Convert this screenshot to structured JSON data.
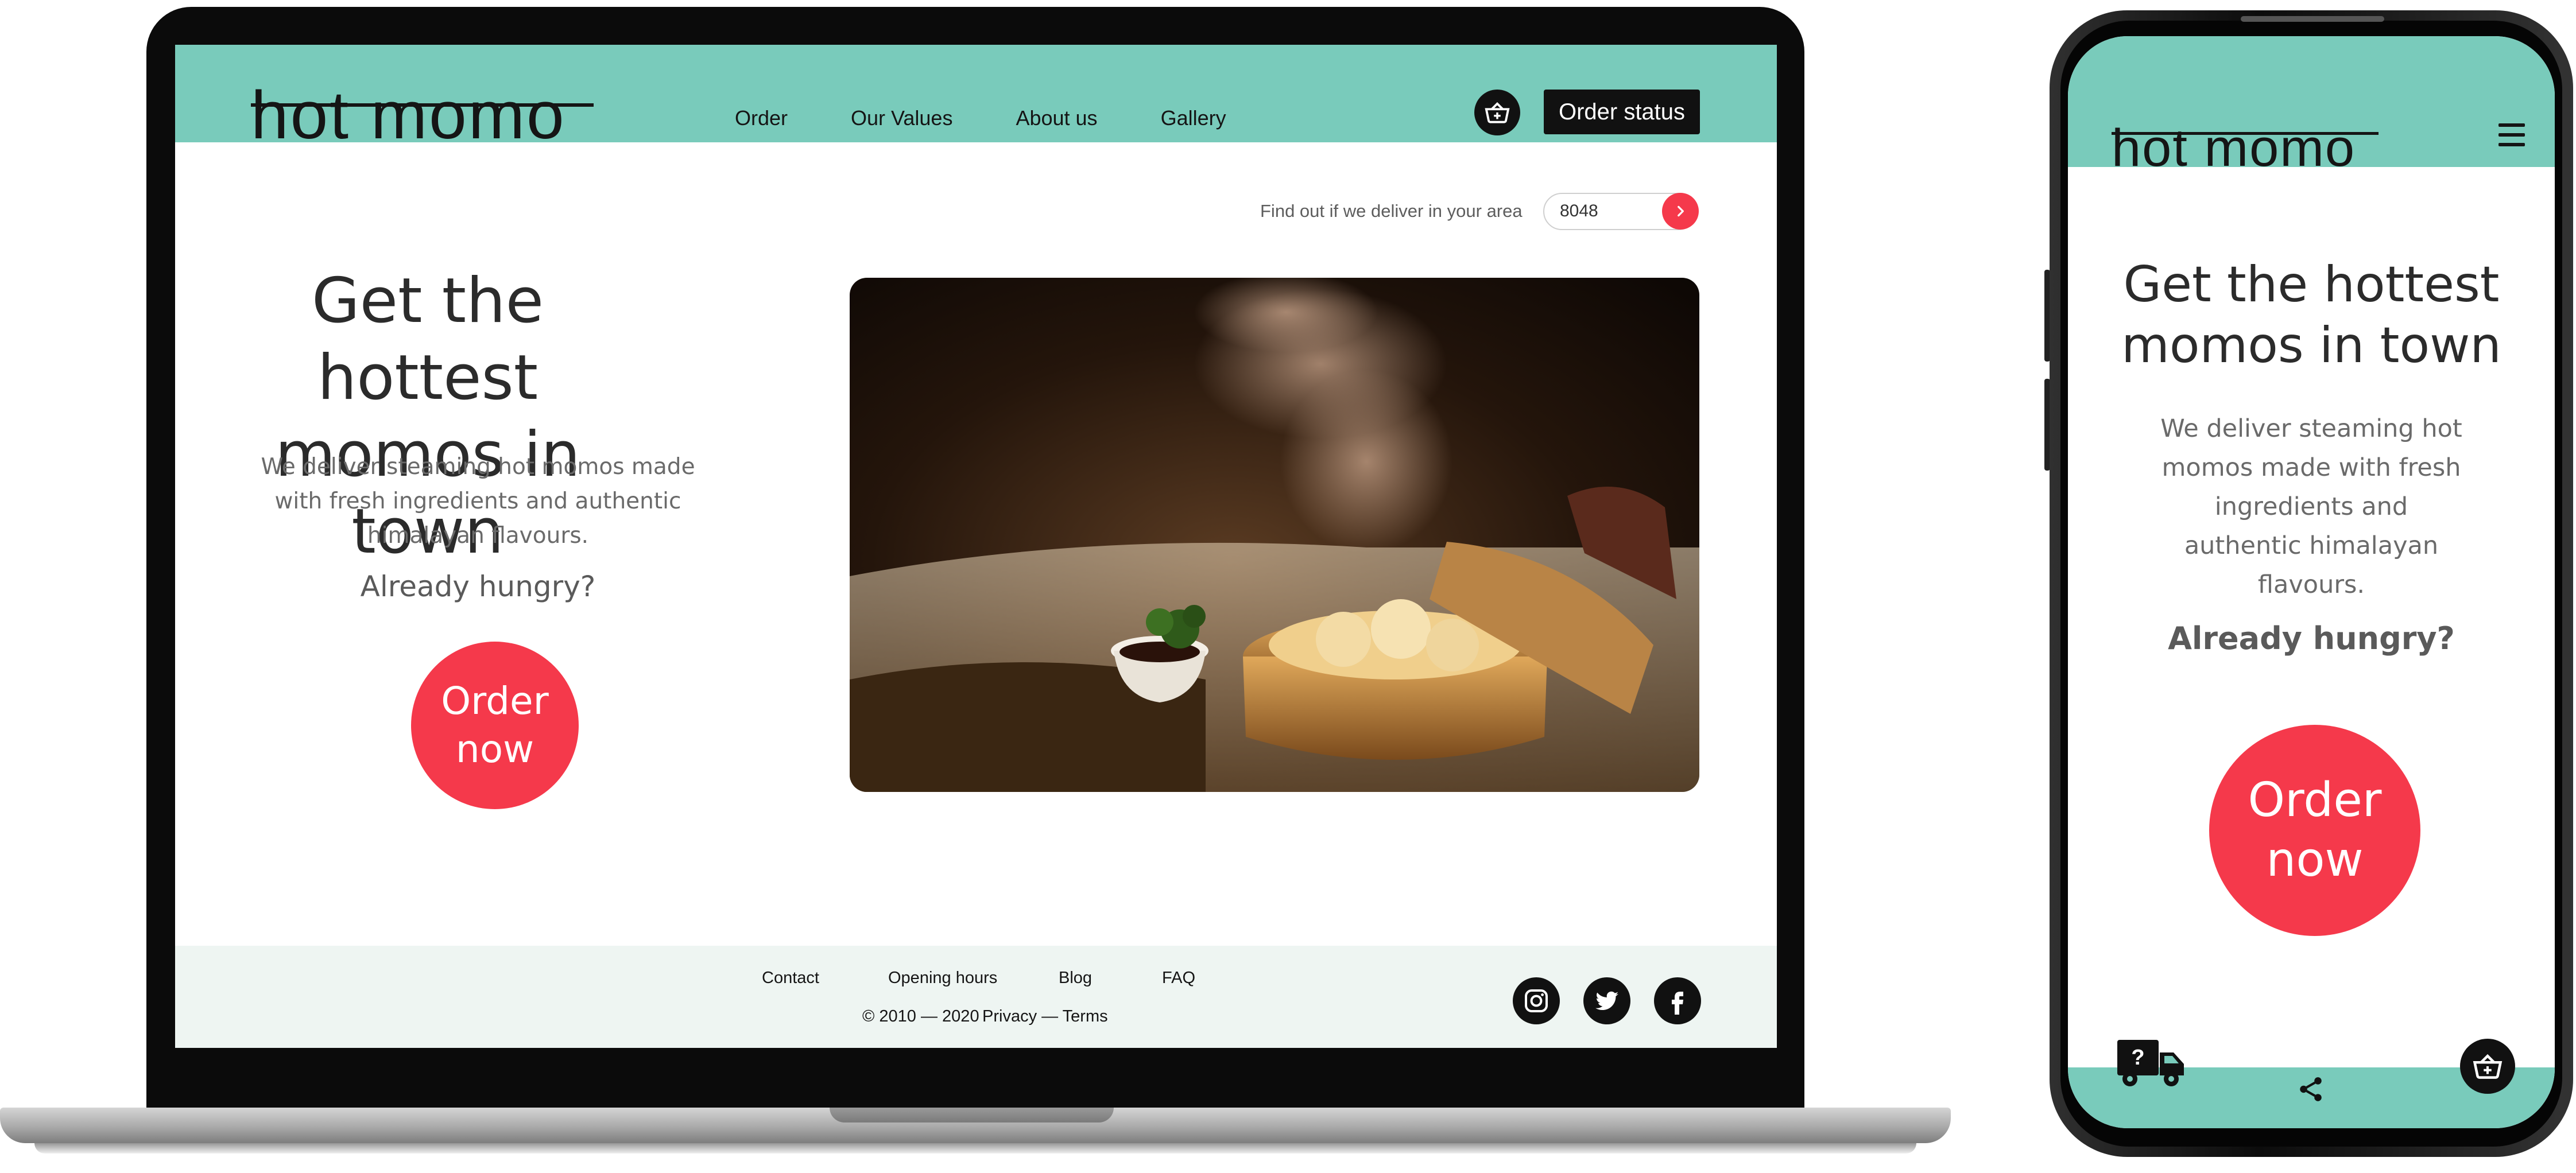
{
  "desktop": {
    "brand": {
      "logo": "hot momo"
    },
    "nav": {
      "items": [
        "Order",
        "Our Values",
        "About us",
        "Gallery"
      ],
      "order_status": "Order status",
      "cart_icon": "basket-icon"
    },
    "delivery": {
      "label": "Find out if we deliver in your area",
      "postcode": "8048",
      "submit_icon": "chevron-right-icon"
    },
    "hero": {
      "title_line1": "Get the hottest",
      "title_line2": "momos in town",
      "description": "We deliver steaming hot momos made with fresh ingredients and authentic himalayan flavours.",
      "question": "Already hungry?",
      "cta_line1": "Order",
      "cta_line2": "now"
    },
    "footer": {
      "links": [
        "Contact",
        "Opening hours",
        "Blog",
        "FAQ"
      ],
      "copyright": "© 2010 — 2020",
      "legal": "Privacy — Terms",
      "social": [
        "instagram-icon",
        "twitter-icon",
        "facebook-icon"
      ]
    }
  },
  "mobile": {
    "brand": {
      "logo": "hot momo"
    },
    "menu_icon": "hamburger-menu-icon",
    "hero": {
      "title_line1": "Get the hottest",
      "title_line2": "momos in town",
      "description": "We deliver steaming hot momos made with fresh ingredients and authentic himalayan flavours.",
      "question": "Already hungry?",
      "cta_line1": "Order",
      "cta_line2": "now"
    },
    "bottom_bar": {
      "icons": [
        "delivery-truck-icon",
        "share-icon",
        "basket-icon"
      ],
      "truck_badge": "?"
    }
  },
  "colors": {
    "accent_teal": "#79cbbb",
    "cta_red": "#f5394b",
    "dark": "#111111",
    "footer_bg": "#eef5f2"
  }
}
